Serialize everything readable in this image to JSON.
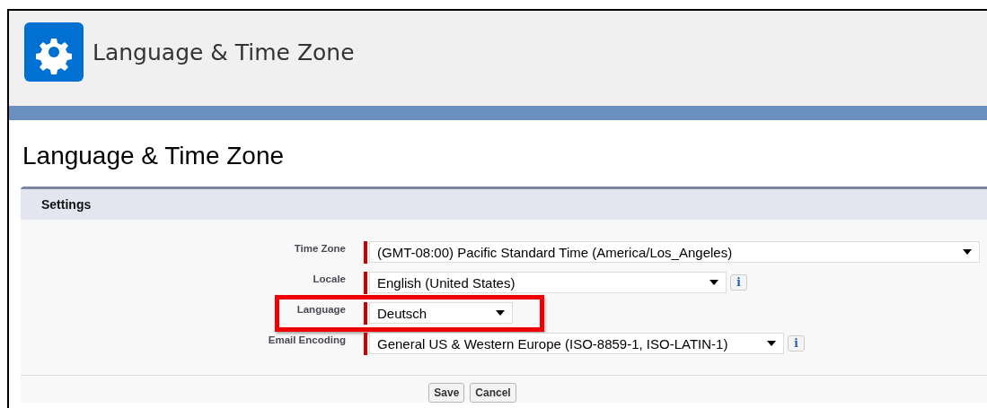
{
  "header": {
    "title": "Language & Time Zone"
  },
  "page_title": "Language & Time Zone",
  "section": {
    "title": "Settings"
  },
  "fields": [
    {
      "label": "Time Zone",
      "value": "(GMT-08:00) Pacific Standard Time (America/Los_Angeles)",
      "required": true,
      "highlighted": false
    },
    {
      "label": "Locale",
      "value": "English (United States)",
      "required": true,
      "info": "i",
      "highlighted": false
    },
    {
      "label": "Language",
      "value": "Deutsch",
      "required": true,
      "highlighted": true
    },
    {
      "label": "Email Encoding",
      "value": "General US & Western Europe (ISO-8859-1, ISO-LATIN-1)",
      "required": true,
      "info": "i",
      "highlighted": false
    }
  ],
  "buttons": [
    "Save",
    "Cancel"
  ]
}
